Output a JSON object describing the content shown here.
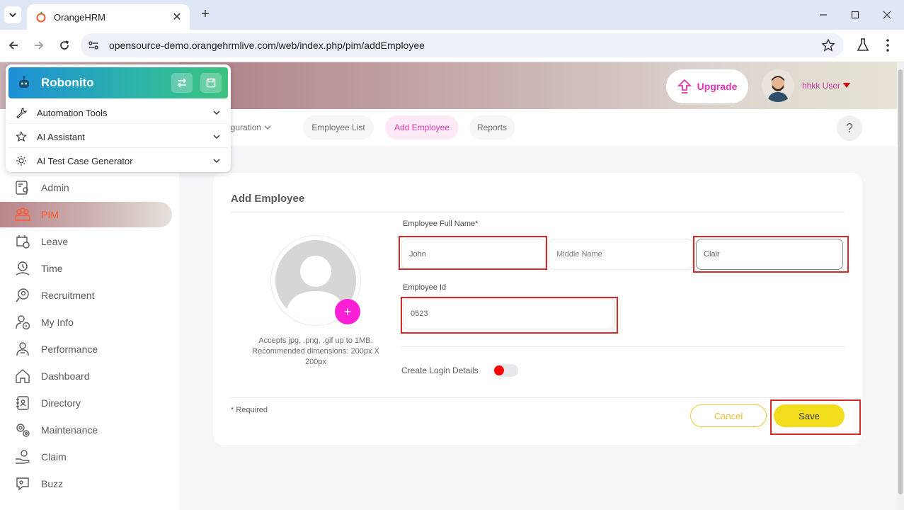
{
  "browser": {
    "tab_title": "OrangeHRM",
    "url": "opensource-demo.orangehrmlive.com/web/index.php/pim/addEmployee"
  },
  "header": {
    "upgrade_label": "Upgrade",
    "user_name": "hhkk User"
  },
  "topnav": {
    "items": [
      {
        "label": "nfiguration"
      },
      {
        "label": "Employee List"
      },
      {
        "label": "Add Employee"
      },
      {
        "label": "Reports"
      }
    ],
    "help_label": "?"
  },
  "sidebar": {
    "items": [
      {
        "label": "Admin",
        "icon": "admin-icon"
      },
      {
        "label": "PIM",
        "icon": "pim-icon"
      },
      {
        "label": "Leave",
        "icon": "leave-icon"
      },
      {
        "label": "Time",
        "icon": "time-icon"
      },
      {
        "label": "Recruitment",
        "icon": "recruitment-icon"
      },
      {
        "label": "My Info",
        "icon": "my-info-icon"
      },
      {
        "label": "Performance",
        "icon": "performance-icon"
      },
      {
        "label": "Dashboard",
        "icon": "dashboard-icon"
      },
      {
        "label": "Directory",
        "icon": "directory-icon"
      },
      {
        "label": "Maintenance",
        "icon": "maintenance-icon"
      },
      {
        "label": "Claim",
        "icon": "claim-icon"
      },
      {
        "label": "Buzz",
        "icon": "buzz-icon"
      }
    ]
  },
  "form": {
    "title": "Add Employee",
    "upload_hint": "Accepts jpg, .png, .gif up to 1MB. Recommended dimensions: 200px X 200px",
    "full_name_label": "Employee Full Name*",
    "first_name_value": "John",
    "middle_name_placeholder": "Middle Name",
    "last_name_value": "Clair",
    "employee_id_label": "Employee Id",
    "employee_id_value": "0523",
    "create_login_label": "Create Login Details",
    "required_note": "* Required",
    "cancel_label": "Cancel",
    "save_label": "Save"
  },
  "robonito": {
    "title": "Robonito",
    "rows": [
      {
        "label": "Automation Tools"
      },
      {
        "label": "AI Assistant"
      },
      {
        "label": "AI Test Case Generator"
      }
    ]
  },
  "colors": {
    "accent": "#ff7b1d",
    "pim_active": "#ff5b28",
    "save": "#f2dd1d",
    "highlight_box": "#d32a2a",
    "robonito_gradient_start": "#1d8fd6",
    "robonito_gradient_end": "#3cc37d"
  }
}
